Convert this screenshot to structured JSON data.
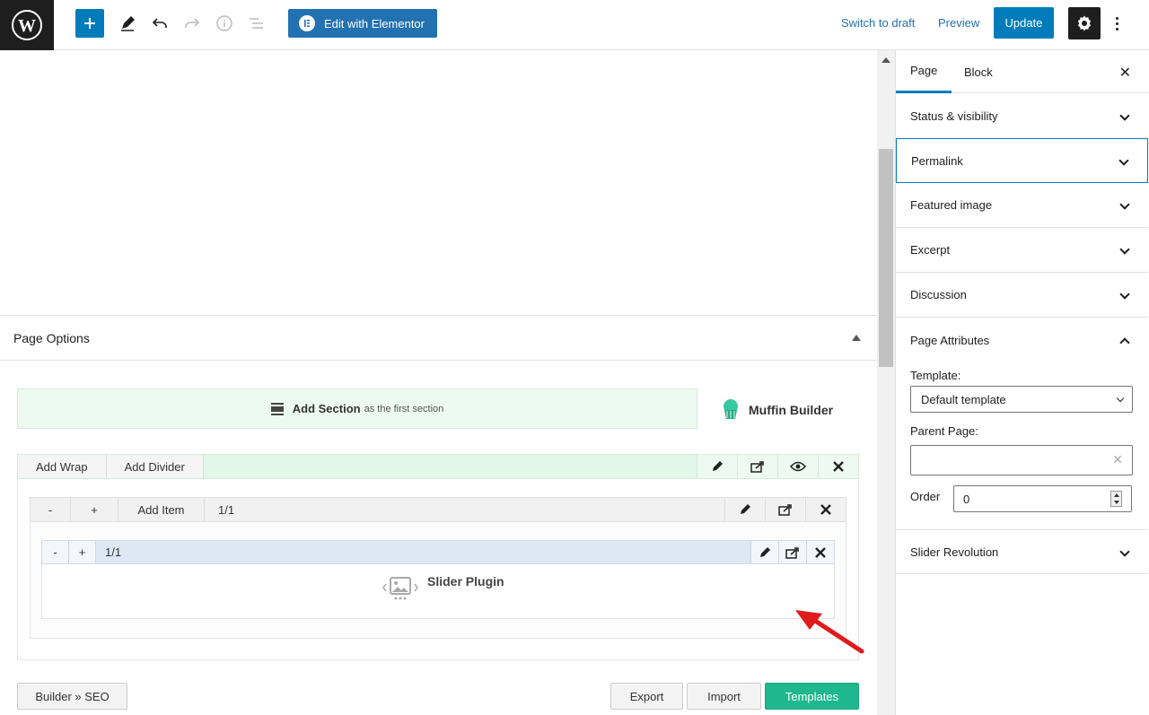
{
  "toolbar": {
    "elementor_label": "Edit with Elementor",
    "switch_draft": "Switch to draft",
    "preview": "Preview",
    "update": "Update"
  },
  "editor": {
    "page_options": "Page Options",
    "add_section": "Add Section",
    "add_section_sub": "as the first section",
    "muffin_brand": "Muffin Builder",
    "wrap_tabs": [
      "Add Wrap",
      "Add Divider"
    ],
    "item": {
      "minus": "-",
      "plus": "+",
      "add_item": "Add Item",
      "size": "1/1"
    },
    "slider": {
      "minus": "-",
      "plus": "+",
      "size": "1/1",
      "title": "Slider Plugin"
    },
    "buttons": {
      "seo": "Builder » SEO",
      "export": "Export",
      "import": "Import",
      "templates": "Templates"
    }
  },
  "sidebar": {
    "tabs": [
      "Page",
      "Block"
    ],
    "close": "✕",
    "panels": [
      "Status & visibility",
      "Permalink",
      "Featured image",
      "Excerpt",
      "Discussion",
      "Page Attributes"
    ],
    "template_label": "Template:",
    "template_value": "Default template",
    "parent_label": "Parent Page:",
    "order_label": "Order",
    "order_value": "0",
    "slider_revolution": "Slider Revolution"
  },
  "colors": {
    "primary": "#007cba",
    "templates_green": "#1fb88e",
    "section_green": "#edfaf1",
    "arrow_red": "#e01b1b"
  }
}
